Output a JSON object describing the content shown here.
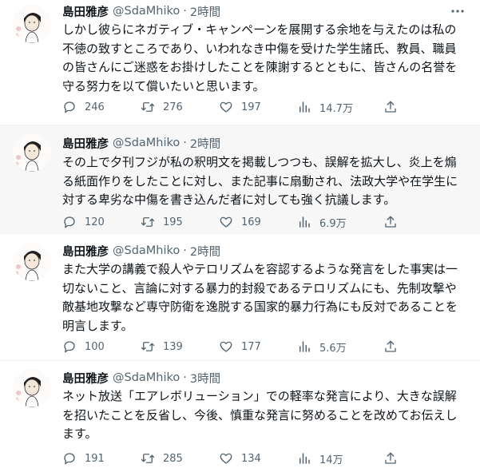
{
  "tweets": [
    {
      "name": "島田雅彦",
      "handle": "@SdaMhiko",
      "sep": "·",
      "time": "2時間",
      "lines": [
        "しかし彼らにネガティブ・キャンペーンを展開する余地を与えたのは私の",
        "不徳の致すところであり、いわれなき中傷を受けた学生諸氏、教員、職員",
        "の皆さんにご迷惑をお掛けしたことを陳謝するとともに、皆さんの名誉を",
        "守る努力を以て償いたいと思います。"
      ],
      "replies": "246",
      "retweets": "276",
      "likes": "197",
      "views": "14.7万"
    },
    {
      "name": "島田雅彦",
      "handle": "@SdaMhiko",
      "sep": "·",
      "time": "2時間",
      "lines": [
        "その上で夕刊フジが私の釈明文を掲載しつつも、誤解を拡大し、炎上を煽",
        "る紙面作りをしたことに対し、また記事に扇動され、法政大学や在学生に",
        "対する卑劣な中傷を書き込んだ者に対しても強く抗議します。"
      ],
      "replies": "120",
      "retweets": "195",
      "likes": "169",
      "views": "6.9万"
    },
    {
      "name": "島田雅彦",
      "handle": "@SdaMhiko",
      "sep": "·",
      "time": "2時間",
      "lines": [
        "また大学の講義で殺人やテロリズムを容認するような発言をした事実は一",
        "切ないこと、言論に対する暴力的封殺であるテロリズムにも、先制攻撃や",
        "敵基地攻撃など専守防衛を逸脱する国家的暴力行為にも反対であることを",
        "明言します。"
      ],
      "replies": "100",
      "retweets": "139",
      "likes": "177",
      "views": "5.6万"
    },
    {
      "name": "島田雅彦",
      "handle": "@SdaMhiko",
      "sep": "·",
      "time": "3時間",
      "lines": [
        "ネット放送「エアレボリューション」での軽率な発言により、大きな誤解",
        "を招いたことを反省し、今後、慎重な発言に努めることを改めてお伝えし",
        "ます。"
      ],
      "replies": "191",
      "retweets": "285",
      "likes": "134",
      "views": "14万"
    }
  ],
  "icons": {
    "reply": "speech-bubble",
    "retweet": "two-arrows-loop",
    "like": "heart-outline",
    "views": "bar-chart",
    "share": "upload-arrow",
    "more": "three-dots"
  },
  "colors": {
    "text": "#0f1419",
    "secondary": "#536471",
    "hover_background": "#f7f7f7",
    "divider": "#eff3f4"
  }
}
